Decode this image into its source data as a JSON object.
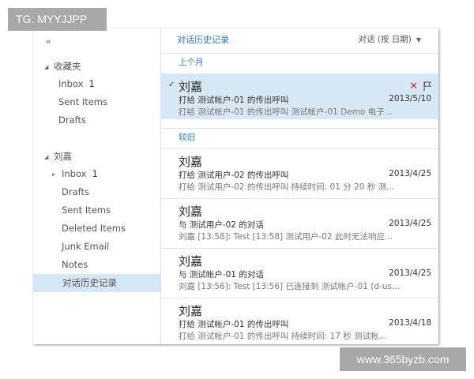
{
  "watermarks": {
    "top_left": "TG: MYYJJPP",
    "bottom_right": "www.365byzb.com"
  },
  "sidebar": {
    "collapse_glyph": "«",
    "favorites_header": "收藏夹",
    "favorites": [
      {
        "label": "Inbox",
        "count": "1"
      },
      {
        "label": "Sent Items"
      },
      {
        "label": "Drafts"
      }
    ],
    "account_header": "刘嘉",
    "folders": [
      {
        "label": "Inbox",
        "count": "1"
      },
      {
        "label": "Drafts"
      },
      {
        "label": "Sent Items"
      },
      {
        "label": "Deleted Items"
      },
      {
        "label": "Junk Email"
      },
      {
        "label": "Notes"
      },
      {
        "label": "对话历史记录",
        "selected": true
      }
    ]
  },
  "message_list": {
    "title": "对话历史记录",
    "sort_label": "对话 (按 日期)",
    "groups": [
      "上个月",
      "较旧"
    ],
    "messages": [
      {
        "from": "刘嘉",
        "subject": "打给 测试帐户-01 的传出呼叫",
        "date": "2013/5/10",
        "preview": "打给 测试帐户-01 的传出呼叫 测试帐户-01 Demo 电子...",
        "selected": true
      },
      {
        "from": "刘嘉",
        "subject": "打给 测试用户-02 的传出呼叫",
        "date": "2013/4/25",
        "preview": "打给 测试用户-02 的传出呼叫 持续时间: 01 分 20 秒 测..."
      },
      {
        "from": "刘嘉",
        "subject": "与 测试用户-02 的对话",
        "date": "2013/4/25",
        "preview": "刘嘉 [13:58]: Test [13:58] 测试用户-02 此时无法响应..."
      },
      {
        "from": "刘嘉",
        "subject": "与 测试帐户-01 的对话",
        "date": "2013/4/25",
        "preview": "刘嘉 [13:56]: Test [13:56] 已连接到 测试帐户-01 (d-us..."
      },
      {
        "from": "刘嘉",
        "subject": "打给 测试帐户-01 的传出呼叫",
        "date": "2013/4/18",
        "preview": "打给 测试帐户-01 的传出呼叫 持续时间: 17 秒 测试帐..."
      }
    ]
  },
  "icons": {
    "check": "checkmark-icon",
    "delete": "delete-x-icon",
    "flag": "flag-icon",
    "collapse": "double-chevron-left-icon",
    "expanded": "triangle-down-icon",
    "collapsed": "triangle-right-icon",
    "sort": "chevron-down-icon"
  },
  "colors": {
    "accent": "#2a7ab8",
    "selection": "#d9e8f5",
    "delete": "#c0303c"
  }
}
